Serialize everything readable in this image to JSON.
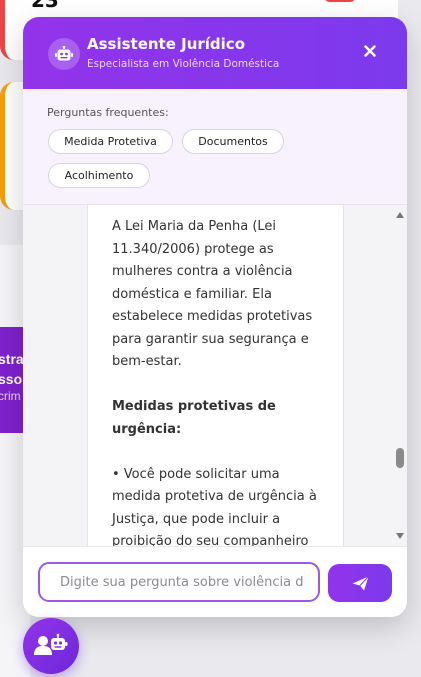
{
  "background": {
    "card_number": "23",
    "banner_lines": [
      "stra",
      "sso",
      "crim"
    ]
  },
  "chat": {
    "title": "Assistente Jurídico",
    "subtitle": "Especialista em Violência Doméstica",
    "faq_label": "Perguntas frequentes:",
    "faq_chips": [
      "Medida Protetiva",
      "Documentos",
      "Acolhimento"
    ],
    "message": {
      "intro": "A Lei Maria da Penha (Lei 11.340/2006) protege as mulheres contra a violência doméstica e familiar. Ela estabelece medidas protetivas para garantir sua segurança e bem-estar.",
      "heading": "Medidas protetivas de urgência:",
      "bullet": "• Você pode solicitar uma medida protetiva de urgência à Justiça, que pode incluir a proibição do seu companheiro"
    },
    "input_placeholder": "Digite sua pergunta sobre violência d",
    "colors": {
      "accent": "#9333ea",
      "accent_dark": "#7c3aed",
      "faq_bg": "#f7f2fd"
    },
    "icons": {
      "header": "robot-icon",
      "close": "close-icon",
      "send": "paper-plane-icon",
      "fab": "user-robot-chat-icon"
    }
  }
}
